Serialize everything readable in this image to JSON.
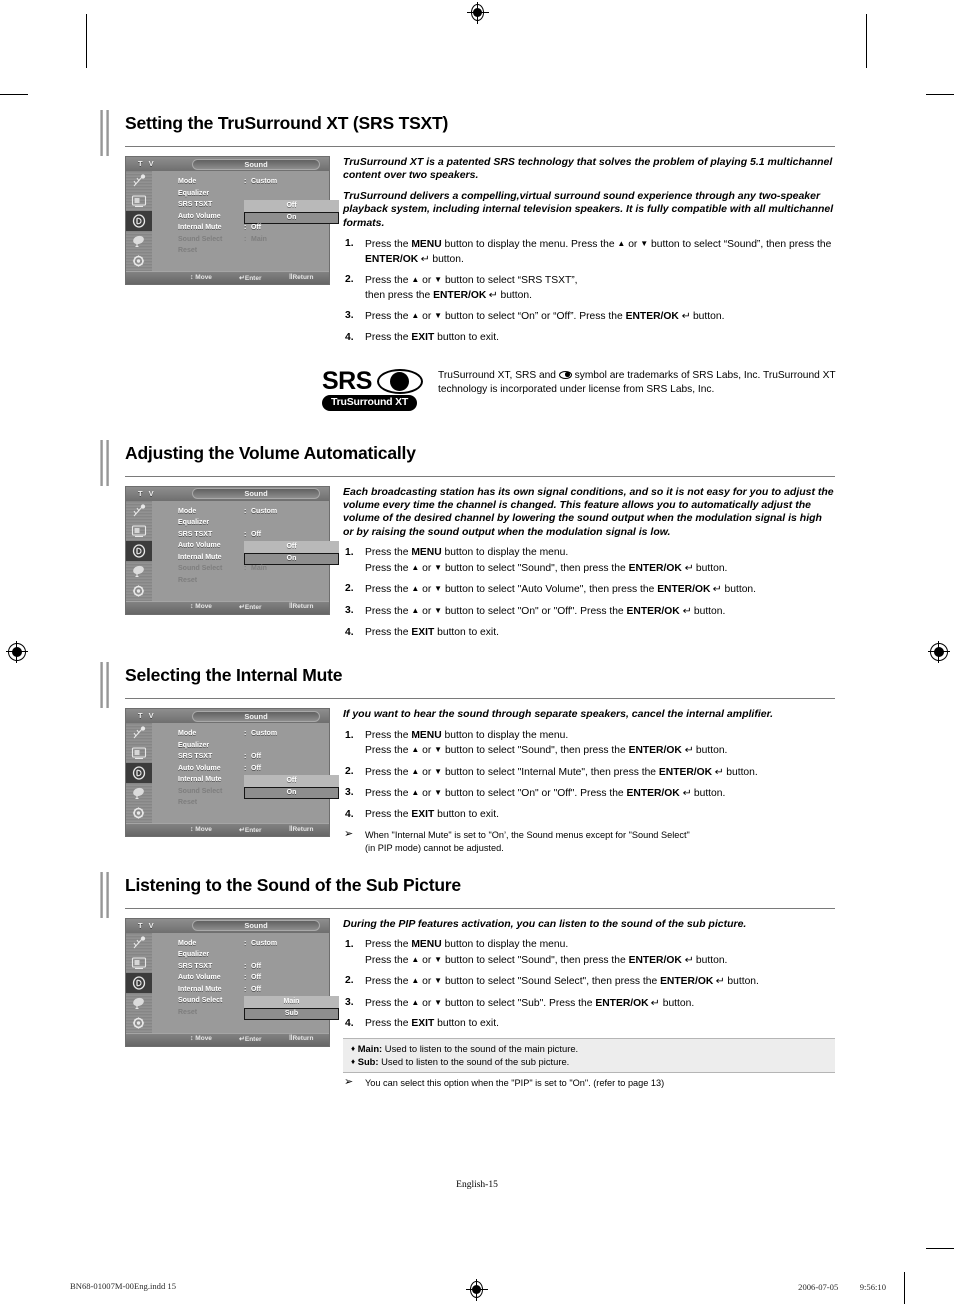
{
  "document": {
    "page_label": "English-15",
    "footer_left": "BN68-01007M-00Eng.indd   15",
    "footer_right": "2006-07-05   　　 9:56:10"
  },
  "osd_common": {
    "tv_label": "T V",
    "menu_title": "Sound",
    "guide": {
      "move": "Move",
      "enter": "Enter",
      "return": "Return",
      "move_glyph": "↕",
      "enter_glyph": "↵",
      "return_glyph": "‖"
    },
    "icons": [
      "antenna-icon",
      "picture-icon",
      "sound-icon",
      "setup-icon",
      "gear-icon"
    ]
  },
  "sections": [
    {
      "id": "srs-tsxt",
      "title": "Setting the TruSurround XT (SRS TSXT)",
      "osd": {
        "selected_icon_index": 2,
        "rows": [
          {
            "label": "Mode",
            "colon": ":",
            "value": "Custom",
            "dim": false,
            "state": "plain"
          },
          {
            "label": "Equalizer",
            "colon": "",
            "value": "",
            "dim": false,
            "state": "plain"
          },
          {
            "label": "SRS TSXT",
            "colon": ":",
            "value": "Off",
            "dim": false,
            "state": "highlight"
          },
          {
            "label": "Auto Volume",
            "colon": ":",
            "value": "On",
            "dim": false,
            "state": "box"
          },
          {
            "label": "Internal Mute",
            "colon": ":",
            "value": "Off",
            "dim": false,
            "state": "plain"
          },
          {
            "label": "Sound Select",
            "colon": ":",
            "value": "Main",
            "dim": true,
            "state": "plain"
          },
          {
            "label": "Reset",
            "colon": "",
            "value": "",
            "dim": true,
            "state": "plain"
          }
        ]
      },
      "lead": [
        "TruSurround XT is a patented SRS technology that solves the problem of playing 5.1 multichannel content over two speakers.",
        "TruSurround delivers a compelling,virtual surround sound experience through any two-speaker playback system, including internal television speakers. It is fully compatible with all multichannel formats."
      ],
      "steps": [
        {
          "num": "1.",
          "html": "Press the <b>MENU</b> button to display the menu. Press the <span class=\"ar\">▲</span> or <span class=\"ar\">▼</span> button to select “Sound”, then press the <b>ENTER/OK</b> <span class=\"enter-gly\">↵</span> button."
        },
        {
          "num": "2.",
          "html": "Press the <span class=\"ar\">▲</span> or <span class=\"ar\">▼</span> button to select “SRS TSXT”,<br>then press the <b>ENTER/OK</b> <span class=\"enter-gly\">↵</span> button."
        },
        {
          "num": "3.",
          "html": "Press the <span class=\"ar\">▲</span> or <span class=\"ar\">▼</span> button to select “On” or “Off”. Press the <b>ENTER/OK</b> <span class=\"enter-gly\">↵</span> button."
        },
        {
          "num": "4.",
          "html": "Press the <b>EXIT</b> button to exit."
        }
      ],
      "trademark": {
        "logo_word": "SRS",
        "logo_pill": "TruSurround XT",
        "text_html": "TruSurround XT, SRS and <span class=\"symbol\"></span> symbol are trademarks of SRS Labs, Inc. TruSurround XT technology is incorporated under license from SRS Labs, Inc."
      }
    },
    {
      "id": "auto-volume",
      "title": "Adjusting the Volume Automatically",
      "osd": {
        "selected_icon_index": 2,
        "rows": [
          {
            "label": "Mode",
            "colon": ":",
            "value": "Custom",
            "dim": false,
            "state": "plain"
          },
          {
            "label": "Equalizer",
            "colon": "",
            "value": "",
            "dim": false,
            "state": "plain"
          },
          {
            "label": "SRS TSXT",
            "colon": ":",
            "value": "Off",
            "dim": false,
            "state": "plain"
          },
          {
            "label": "Auto Volume",
            "colon": ":",
            "value": "Off",
            "dim": false,
            "state": "highlight"
          },
          {
            "label": "Internal Mute",
            "colon": ":",
            "value": "On",
            "dim": false,
            "state": "box"
          },
          {
            "label": "Sound Select",
            "colon": ":",
            "value": "Main",
            "dim": true,
            "state": "plain"
          },
          {
            "label": "Reset",
            "colon": "",
            "value": "",
            "dim": true,
            "state": "plain"
          }
        ]
      },
      "lead": [
        "Each broadcasting station has its own signal conditions, and so it is not easy for you to adjust the volume every time the channel is changed. This feature allows you to automatically adjust the volume of the desired channel by lowering the sound output when the modulation signal is high or by raising the sound output when the modulation signal is low."
      ],
      "steps": [
        {
          "num": "1.",
          "html": "Press the <b>MENU</b> button to display the menu.<br>Press the <span class=\"ar\">▲</span> or <span class=\"ar\">▼</span> button to select \"Sound\", then press the <b>ENTER/OK</b> <span class=\"enter-gly\">↵</span> button."
        },
        {
          "num": "2.",
          "html": "Press the <span class=\"ar\">▲</span> or <span class=\"ar\">▼</span> button to select \"Auto Volume\", then press the <b>ENTER/OK</b> <span class=\"enter-gly\">↵</span> button."
        },
        {
          "num": "3.",
          "html": "Press the <span class=\"ar\">▲</span> or <span class=\"ar\">▼</span> button to select \"On\" or \"Off\". Press the <b>ENTER/OK</b> <span class=\"enter-gly\">↵</span> button."
        },
        {
          "num": "4.",
          "html": "Press the <b>EXIT</b> button to exit."
        }
      ]
    },
    {
      "id": "internal-mute",
      "title": "Selecting the Internal Mute",
      "osd": {
        "selected_icon_index": 2,
        "rows": [
          {
            "label": "Mode",
            "colon": ":",
            "value": "Custom",
            "dim": false,
            "state": "plain"
          },
          {
            "label": "Equalizer",
            "colon": "",
            "value": "",
            "dim": false,
            "state": "plain"
          },
          {
            "label": "SRS TSXT",
            "colon": ":",
            "value": "Off",
            "dim": false,
            "state": "plain"
          },
          {
            "label": "Auto Volume",
            "colon": ":",
            "value": "Off",
            "dim": false,
            "state": "plain"
          },
          {
            "label": "Internal Mute",
            "colon": ":",
            "value": "Off",
            "dim": false,
            "state": "highlight"
          },
          {
            "label": "Sound Select",
            "colon": ":",
            "value": "On",
            "dim": true,
            "state": "box"
          },
          {
            "label": "Reset",
            "colon": "",
            "value": "",
            "dim": true,
            "state": "plain"
          }
        ]
      },
      "lead": [
        "If you want to hear the sound through separate speakers, cancel the internal amplifier."
      ],
      "steps": [
        {
          "num": "1.",
          "html": "Press the <b>MENU</b> button to display the menu.<br>Press the <span class=\"ar\">▲</span> or <span class=\"ar\">▼</span> button to select \"Sound\", then press the <b>ENTER/OK</b> <span class=\"enter-gly\">↵</span> button."
        },
        {
          "num": "2.",
          "html": "Press the <span class=\"ar\">▲</span> or <span class=\"ar\">▼</span> button to select \"Internal Mute\", then press the <b>ENTER/OK</b> <span class=\"enter-gly\">↵</span> button."
        },
        {
          "num": "3.",
          "html": "Press the <span class=\"ar\">▲</span> or <span class=\"ar\">▼</span> button to select \"On\" or \"Off\". Press the <b>ENTER/OK</b> <span class=\"enter-gly\">↵</span> button."
        },
        {
          "num": "4.",
          "html": "Press the <b>EXIT</b> button to exit."
        }
      ],
      "notes": [
        {
          "glyph": "➢",
          "html": "When \"Internal Mute\" is set to \"On’, the Sound menus except for \"Sound Select\"<br>(in PIP mode) cannot be adjusted."
        }
      ]
    },
    {
      "id": "sub-picture-sound",
      "title": "Listening to the Sound of the Sub Picture",
      "osd": {
        "selected_icon_index": 2,
        "rows": [
          {
            "label": "Mode",
            "colon": ":",
            "value": "Custom",
            "dim": false,
            "state": "plain"
          },
          {
            "label": "Equalizer",
            "colon": "",
            "value": "",
            "dim": false,
            "state": "plain"
          },
          {
            "label": "SRS TSXT",
            "colon": ":",
            "value": "Off",
            "dim": false,
            "state": "plain"
          },
          {
            "label": "Auto Volume",
            "colon": ":",
            "value": "Off",
            "dim": false,
            "state": "plain"
          },
          {
            "label": "Internal Mute",
            "colon": ":",
            "value": "Off",
            "dim": false,
            "state": "plain"
          },
          {
            "label": "Sound Select",
            "colon": ":",
            "value": "Main",
            "dim": false,
            "state": "highlight"
          },
          {
            "label": "Reset",
            "colon": "",
            "value": "Sub",
            "dim": true,
            "state": "box"
          }
        ]
      },
      "lead": [
        "During the PIP features activation, you can listen to the sound of the sub picture."
      ],
      "steps": [
        {
          "num": "1.",
          "html": "Press the <b>MENU</b> button to display the menu.<br>Press the <span class=\"ar\">▲</span> or <span class=\"ar\">▼</span> button to select \"Sound\", then press the <b>ENTER/OK</b> <span class=\"enter-gly\">↵</span> button."
        },
        {
          "num": "2.",
          "html": "Press the <span class=\"ar\">▲</span> or <span class=\"ar\">▼</span> button to select \"Sound Select\", then press the <b>ENTER/OK</b> <span class=\"enter-gly\">↵</span> button."
        },
        {
          "num": "3.",
          "html": "Press the <span class=\"ar\">▲</span> or <span class=\"ar\">▼</span> button to select \"Sub\". Press the <b>ENTER/OK</b> <span class=\"enter-gly\">↵</span> button."
        },
        {
          "num": "4.",
          "html": "Press the <b>EXIT</b> button to exit."
        }
      ],
      "infobox": [
        {
          "bullet": "♦",
          "term": "Main:",
          "rest": " Used to listen to the sound of the main picture."
        },
        {
          "bullet": "♦",
          "term": "Sub:",
          "rest": " Used to listen to the sound of the sub picture."
        }
      ],
      "notes": [
        {
          "glyph": "➢",
          "html": "You can select this option when the \"PIP\" is set to \"On\". (refer to page 13)"
        }
      ]
    }
  ]
}
